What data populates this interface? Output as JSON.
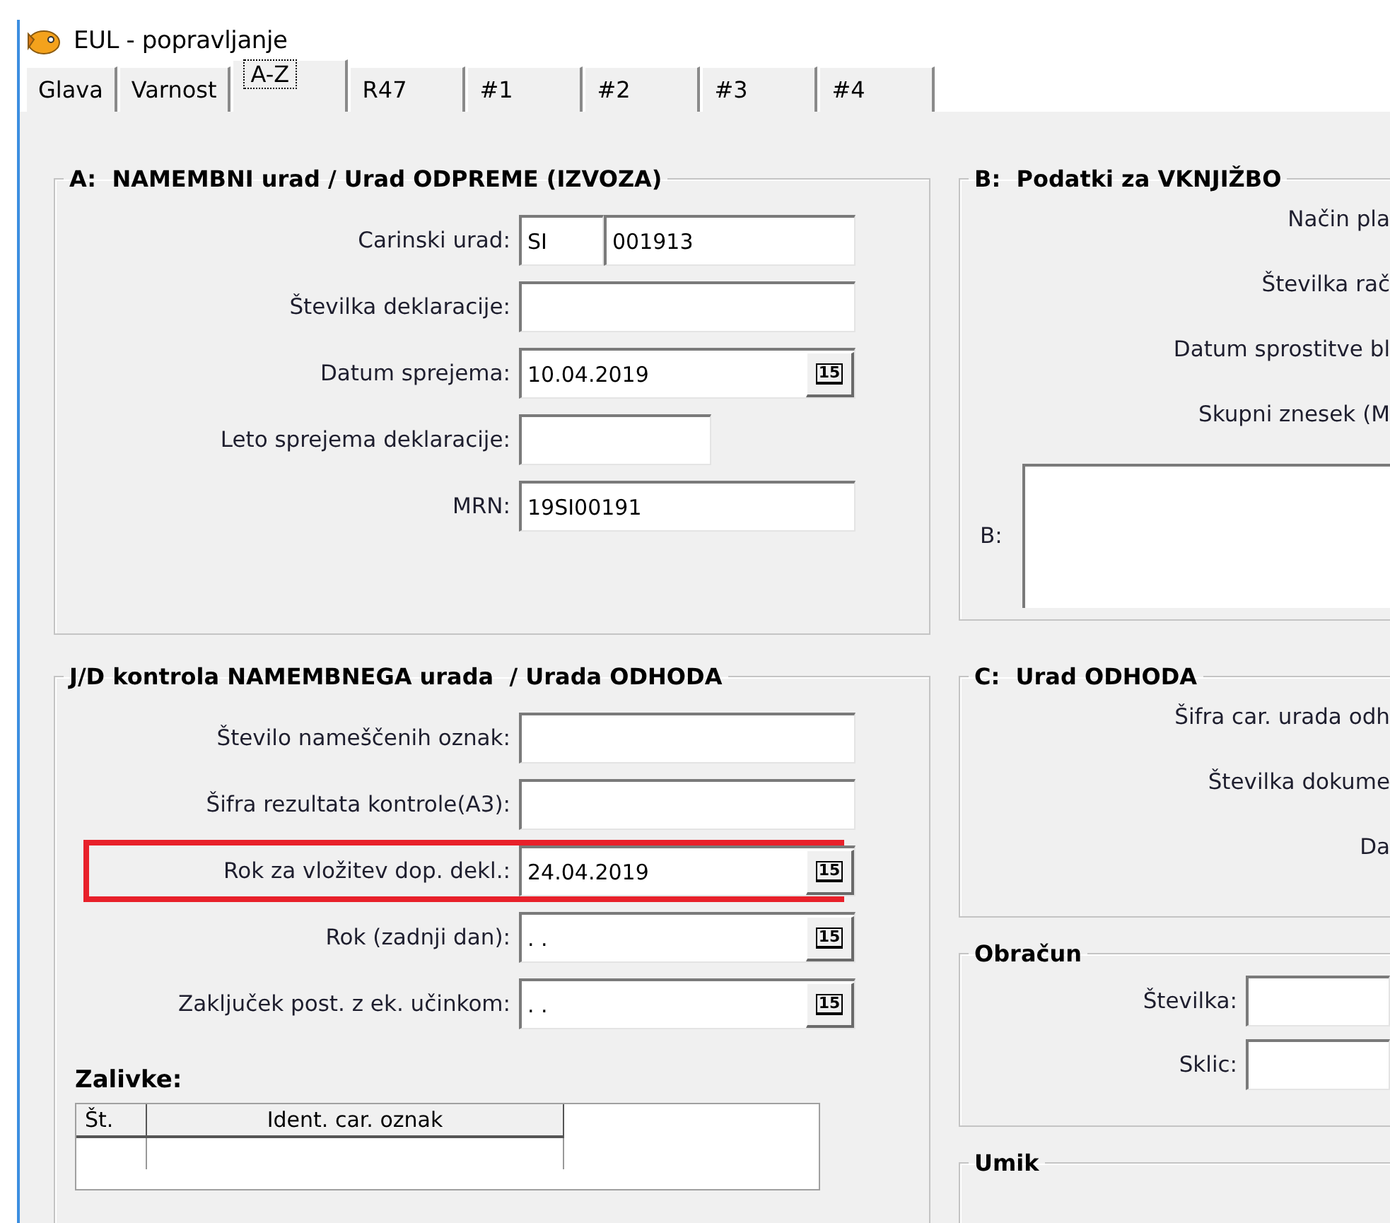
{
  "window": {
    "title": "EUL - popravljanje"
  },
  "tabs": [
    {
      "label": "Glava",
      "selected": false
    },
    {
      "label": "Varnost",
      "selected": false
    },
    {
      "label": "A-Z",
      "selected": true
    },
    {
      "label": "R47",
      "selected": false
    },
    {
      "label": "#1",
      "selected": false
    },
    {
      "label": "#2",
      "selected": false
    },
    {
      "label": "#3",
      "selected": false
    },
    {
      "label": "#4",
      "selected": false
    }
  ],
  "group_a": {
    "title": "A:  NAMEMBNI urad / Urad ODPREME (IZVOZA)",
    "fields": [
      {
        "kind": "code",
        "label": "Carinski urad:",
        "country": "SI",
        "code": "001913"
      },
      {
        "kind": "text",
        "label": "Številka deklaracije:"
      },
      {
        "kind": "date",
        "label": "Datum sprejema:",
        "value": "10.04.2019",
        "button": "15"
      },
      {
        "kind": "short",
        "label": "Leto sprejema deklaracije:"
      },
      {
        "kind": "text",
        "label": "MRN:",
        "value": "19SI00191"
      }
    ]
  },
  "group_jd": {
    "title": "J/D kontrola NAMEMBNEGA urada  / Urada ODHODA",
    "fields": [
      {
        "kind": "text",
        "label": "Število nameščenih oznak:",
        "highlighted": false
      },
      {
        "kind": "text",
        "label": "Šifra rezultata kontrole(A3):",
        "highlighted": false
      },
      {
        "kind": "date",
        "label": "Rok za vložitev dop. dekl.:",
        "value": "24.04.2019",
        "button": "15",
        "highlighted": true
      },
      {
        "kind": "date",
        "label": "Rok (zadnji dan):",
        "value": ". .",
        "button": "15",
        "highlighted": false
      },
      {
        "kind": "date",
        "label": "Zaključek post. z ek. učinkom:",
        "value": ". .",
        "button": "15",
        "highlighted": false
      }
    ],
    "table_title": "Zalivke:",
    "table": {
      "columns": [
        "Št.",
        "Ident. car. oznak"
      ]
    }
  },
  "group_b": {
    "title": "B:  Podatki za VKNJIŽBO",
    "labels": [
      "Način pla",
      "Številka rač",
      "Datum sprostitve bl",
      "Skupni znesek (M"
    ],
    "memo_label": "B:"
  },
  "group_c": {
    "title": "C:  Urad ODHODA",
    "labels": [
      "Šifra car. urada odh",
      "Številka dokume",
      "Da"
    ]
  },
  "obracun": {
    "title": "Obračun",
    "fields": [
      {
        "label": "Številka:"
      },
      {
        "label": "Sklic:"
      }
    ]
  },
  "umik": {
    "title": "Umik"
  }
}
